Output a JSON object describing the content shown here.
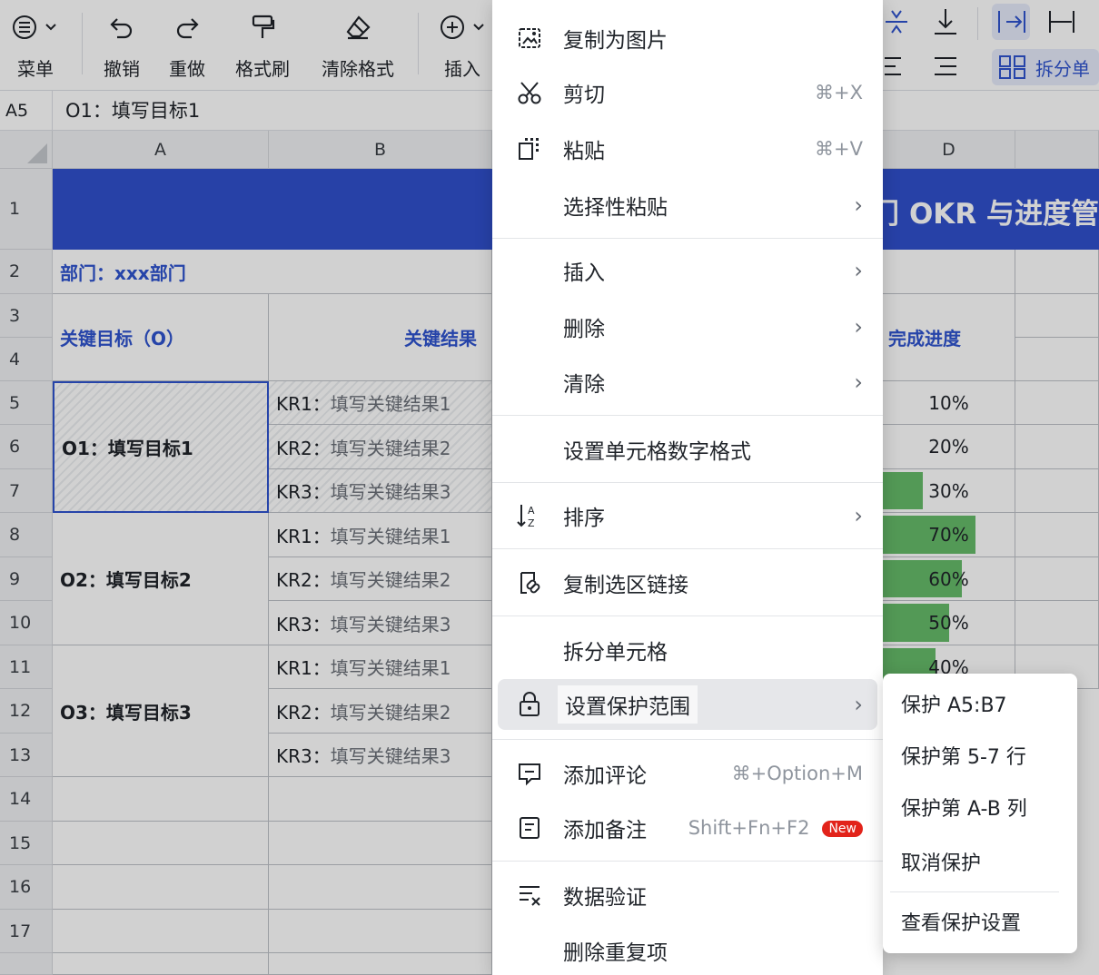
{
  "toolbar": {
    "menu_label": "菜单",
    "undo_label": "撤销",
    "redo_label": "重做",
    "format_painter_label": "格式刷",
    "clear_format_label": "清除格式",
    "insert_label": "插入",
    "split_label": "拆分单"
  },
  "formula_bar": {
    "cell_ref": "A5",
    "value": "O1：填写目标1"
  },
  "columns": [
    "A",
    "B",
    "D"
  ],
  "rows": [
    "1",
    "2",
    "3",
    "4",
    "5",
    "6",
    "7",
    "8",
    "9",
    "10",
    "11",
    "12",
    "13",
    "14",
    "15",
    "16",
    "17"
  ],
  "sheet": {
    "title_fragment": "部门 OKR 与进度管",
    "department": "部门：xxx部门",
    "header_objective": "关键目标（O）",
    "header_kr": "关键结果",
    "header_progress": "完成进度",
    "objectives": [
      "O1：填写目标1",
      "O2：填写目标2",
      "O3：填写目标3"
    ],
    "key_results": [
      {
        "prefix": "KR1：",
        "text": "填写关键结果1",
        "progress": "10%",
        "fill": 0.0
      },
      {
        "prefix": "KR2：",
        "text": "填写关键结果2",
        "progress": "20%",
        "fill": 0.0
      },
      {
        "prefix": "KR3：",
        "text": "填写关键结果3",
        "progress": "30%",
        "fill": 0.3
      },
      {
        "prefix": "KR1：",
        "text": "填写关键结果1",
        "progress": "70%",
        "fill": 0.7
      },
      {
        "prefix": "KR2：",
        "text": "填写关键结果2",
        "progress": "60%",
        "fill": 0.6
      },
      {
        "prefix": "KR3：",
        "text": "填写关键结果3",
        "progress": "50%",
        "fill": 0.5
      },
      {
        "prefix": "KR1：",
        "text": "填写关键结果1",
        "progress": "40%",
        "fill": 0.4
      },
      {
        "prefix": "KR2：",
        "text": "填写关键结果2",
        "progress": "",
        "fill": 0.0
      },
      {
        "prefix": "KR3：",
        "text": "填写关键结果3",
        "progress": "",
        "fill": 0.0
      }
    ]
  },
  "context_menu": {
    "copy_as_image": "复制为图片",
    "cut": "剪切",
    "cut_shortcut": "⌘+X",
    "paste": "粘贴",
    "paste_shortcut": "⌘+V",
    "paste_special": "选择性粘贴",
    "insert": "插入",
    "delete": "删除",
    "clear": "清除",
    "number_format": "设置单元格数字格式",
    "sort": "排序",
    "copy_link": "复制选区链接",
    "split_cells": "拆分单元格",
    "protect_range": "设置保护范围",
    "add_comment": "添加评论",
    "add_comment_shortcut": "⌘+Option+M",
    "add_note": "添加备注",
    "add_note_shortcut": "Shift+Fn+F2",
    "new_badge": "New",
    "data_validation": "数据验证",
    "remove_duplicates": "删除重复项"
  },
  "submenu": {
    "protect_range": "保护 A5:B7",
    "protect_rows": "保护第 5-7 行",
    "protect_cols": "保护第 A-B 列",
    "unprotect": "取消保护",
    "view_settings": "查看保护设置"
  },
  "colors": {
    "accent": "#2f54cf",
    "title_bg": "#3050cc",
    "progress": "#66bb6a"
  }
}
